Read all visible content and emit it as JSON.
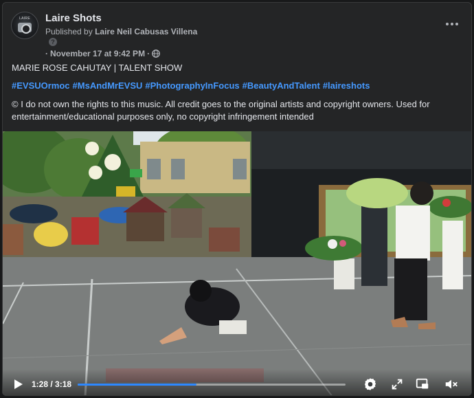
{
  "post": {
    "page_name": "Laire Shots",
    "avatar_text": "LAIRE",
    "published_prefix": "Published by",
    "published_by": "Laire Neil Cabusas Villena",
    "help_icon": "question-icon",
    "timestamp": "November 17 at 9:42 PM",
    "meta_prefix": "·",
    "meta_separator": "·",
    "privacy_icon": "globe-icon",
    "more_icon": "more-options-icon",
    "title": "MARIE ROSE CAHUTAY | TALENT SHOW",
    "hashtags": [
      "#EVSUOrmoc",
      "#MsAndMrEVSU",
      "#PhotographyInFocus",
      "#BeautyAndTalent",
      "#laireshots"
    ],
    "disclaimer": "© I do not own the rights to this music. All credit goes to the original artists and copyright owners. Used for entertainment/educational purposes only, no copyright infringement intended"
  },
  "video": {
    "current_time": "1:28",
    "duration": "3:18",
    "time_display": "1:28 / 3:18",
    "progress": 0.444,
    "icons": {
      "play": "play-icon",
      "settings": "gear-icon",
      "fullscreen": "fullscreen-icon",
      "pip": "picture-in-picture-icon",
      "volume": "volume-muted-icon"
    }
  },
  "colors": {
    "background": "#18191a",
    "card": "#242526",
    "primary_text": "#e4e6eb",
    "secondary_text": "#b0b3b8",
    "link": "#4599ff",
    "progress": "#2d88ff"
  }
}
